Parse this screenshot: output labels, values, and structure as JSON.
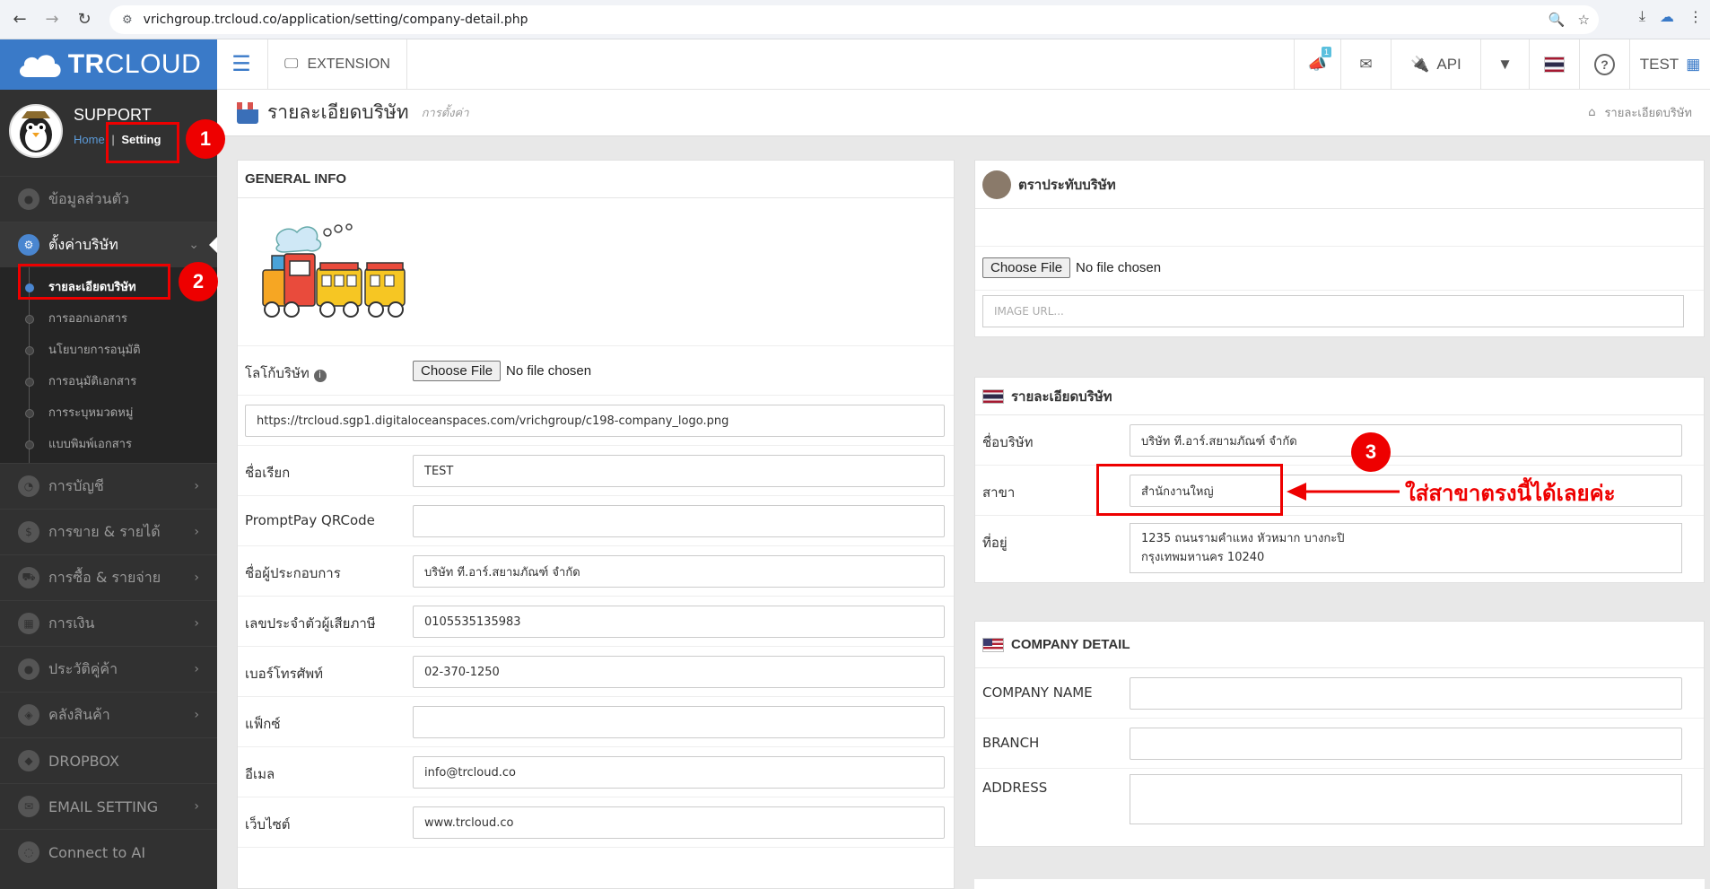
{
  "browser": {
    "url": "vrichgroup.trcloud.co/application/setting/company-detail.php"
  },
  "header": {
    "brand_bold": "TR",
    "brand_light": "CLOUD",
    "extension_label": "EXTENSION",
    "notification_count": "1",
    "api_label": "API",
    "user_label": "TEST"
  },
  "sidebar": {
    "username": "SUPPORT",
    "home_link": "Home",
    "separator": "|",
    "setting_link": "Setting",
    "items": [
      {
        "label": "ข้อมูลส่วนตัว",
        "icon": "user-icon"
      },
      {
        "label": "ตั้งค่าบริษัท",
        "icon": "gear-icon"
      }
    ],
    "sub_items": [
      {
        "label": "รายละเอียดบริษัท"
      },
      {
        "label": "การออกเอกสาร"
      },
      {
        "label": "นโยบายการอนุมัติ"
      },
      {
        "label": "การอนุมัติเอกสาร"
      },
      {
        "label": "การระบุหมวดหมู่"
      },
      {
        "label": "แบบพิมพ์เอกสาร"
      }
    ],
    "lower_items": [
      {
        "label": "การบัญชี"
      },
      {
        "label": "การขาย & รายได้"
      },
      {
        "label": "การซื้อ & รายจ่าย"
      },
      {
        "label": "การเงิน"
      },
      {
        "label": "ประวัติคู่ค้า"
      },
      {
        "label": "คลังสินค้า"
      },
      {
        "label": "DROPBOX"
      },
      {
        "label": "EMAIL SETTING"
      },
      {
        "label": "Connect to AI"
      }
    ]
  },
  "page": {
    "title": "รายละเอียดบริษัท",
    "subtitle": "การตั้งค่า",
    "breadcrumb": "รายละเอียดบริษัท"
  },
  "general": {
    "title": "GENERAL INFO",
    "logo_label": "โลโก้บริษัท",
    "choose_file": "Choose File",
    "no_file": "No file chosen",
    "logo_url": "https://trcloud.sgp1.digitaloceanspaces.com/vrichgroup/c198-company_logo.png",
    "fields": [
      {
        "label": "ชื่อเรียก",
        "value": "TEST"
      },
      {
        "label": "PromptPay QRCode",
        "value": ""
      },
      {
        "label": "ชื่อผู้ประกอบการ",
        "value": "บริษัท ที.อาร์.สยามภัณฑ์ จำกัด"
      },
      {
        "label": "เลขประจำตัวผู้เสียภาษี",
        "value": "0105535135983"
      },
      {
        "label": "เบอร์โทรศัพท์",
        "value": "02-370-1250"
      },
      {
        "label": "แฟ็กซ์",
        "value": ""
      },
      {
        "label": "อีเมล",
        "value": "info@trcloud.co"
      },
      {
        "label": "เว็บไซต์",
        "value": "www.trcloud.co"
      }
    ]
  },
  "seal": {
    "title": "ตราประทับบริษัท",
    "choose_file": "Choose File",
    "no_file": "No file chosen",
    "url_placeholder": "IMAGE URL..."
  },
  "thai_detail": {
    "title": "รายละเอียดบริษัท",
    "name_label": "ชื่อบริษัท",
    "name_value": "บริษัท ที.อาร์.สยามภัณฑ์ จำกัด",
    "branch_label": "สาขา",
    "branch_value": "สำนักงานใหญ่",
    "address_label": "ที่อยู่",
    "address_line1": "1235 ถนนรามคำแหง หัวหมาก บางกะปิ",
    "address_line2": "กรุงเทพมหานคร 10240"
  },
  "en_detail": {
    "title": "COMPANY DETAIL",
    "name_label": "COMPANY NAME",
    "branch_label": "BRANCH",
    "address_label": "ADDRESS"
  },
  "annotations": {
    "n1": "1",
    "n2": "2",
    "n3": "3",
    "note": "ใส่สาขาตรงนี้ได้เลยค่ะ"
  }
}
